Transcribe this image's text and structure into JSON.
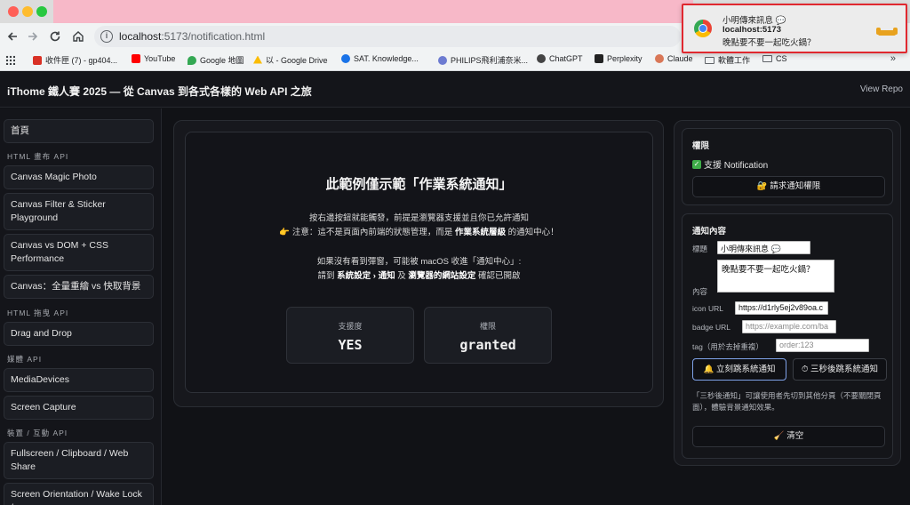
{
  "browser": {
    "url_host": "localhost",
    "url_path": ":5173/notification.html",
    "bookmarks": [
      {
        "label": "收件匣 (7) - gp404...",
        "icon": "gmail-icon",
        "color": "#d93025"
      },
      {
        "label": "YouTube",
        "icon": "youtube-icon",
        "color": "#ff0000"
      },
      {
        "label": "Google 地圖",
        "icon": "maps-icon",
        "color": "#34a853"
      },
      {
        "label": "以 - Google Drive",
        "icon": "drive-icon",
        "color": "#fbbc04"
      },
      {
        "label": "SAT. Knowledge...",
        "icon": "sat-icon",
        "color": "#1a73e8"
      },
      {
        "label": "PHILIPS飛利浦奈米...",
        "icon": "philips-icon",
        "color": "#6d7bd1"
      },
      {
        "label": "ChatGPT",
        "icon": "chatgpt-icon",
        "color": "#444"
      },
      {
        "label": "Perplexity",
        "icon": "perplexity-icon",
        "color": "#222"
      },
      {
        "label": "Claude",
        "icon": "claude-icon",
        "color": "#d97757"
      },
      {
        "label": "軟體工作",
        "icon": "folder-icon",
        "color": ""
      },
      {
        "label": "CS",
        "icon": "folder-icon",
        "color": ""
      }
    ],
    "more": "»"
  },
  "site": {
    "title": "iThome 鐵人賽 2025 — 從 Canvas 到各式各樣的 Web API 之旅",
    "view_repo": "View Repo"
  },
  "sidebar": {
    "home": "首頁",
    "sections": [
      {
        "title": "HTML 畫布 API"
      },
      {
        "title": "HTML 拖曳 API"
      },
      {
        "title": "媒體 API"
      },
      {
        "title": "裝置 / 互動 API"
      }
    ],
    "items": [
      {
        "label": "Canvas Magic Photo"
      },
      {
        "label": "Canvas Filter & Sticker Playground"
      },
      {
        "label": "Canvas vs DOM + CSS Performance"
      },
      {
        "label": "Canvas：全量重繪 vs 快取背景"
      },
      {
        "label": "Drag and Drop"
      },
      {
        "label": "MediaDevices"
      },
      {
        "label": "Screen Capture"
      },
      {
        "label": "Fullscreen / Clipboard / Web Share"
      },
      {
        "label": "Screen Orientation / Wake Lock /"
      }
    ]
  },
  "main": {
    "heading": "此範例僅示範「作業系統通知」",
    "line1": "按右邊按鈕就能觸發，前提是瀏覽器支援並且你已允許通知",
    "line2_prefix": "👉 注意：這不是頁面內前端的狀態管理，而是 ",
    "line2_bold": "作業系統層級",
    "line2_suffix": " 的通知中心！",
    "line3": "如果沒有看到彈窗，可能被 macOS 收進「通知中心」:",
    "line4_a": "請到 ",
    "line4_b": "系統設定 › 通知",
    "line4_c": " 及 ",
    "line4_d": "瀏覽器的網站設定",
    "line4_e": " 確認已開啟",
    "support_label": "支援度",
    "support_value": "YES",
    "permission_label": "權限",
    "permission_value": "granted"
  },
  "permission_card": {
    "title": "權限",
    "support_text": "支援 Notification",
    "request_button": "🔐 請求通知權限"
  },
  "content_card": {
    "title": "通知內容",
    "title_label": "標題",
    "title_value": "小明傳來訊息 💬",
    "content_label": "內容",
    "content_value": "晚點要不要一起吃火鍋？",
    "icon_label": "icon URL",
    "icon_value": "https://d1rly5ej2v89oa.c",
    "badge_label": "badge URL",
    "badge_placeholder": "https://example.com/ba",
    "tag_label": "tag（用於去掉重複）",
    "tag_placeholder": "order:123",
    "send_now": "🔔 立刻跳系統通知",
    "send_later": "⏱ 三秒後跳系統通知",
    "hint": "「三秒後通知」可讓使用者先切到其他分頁（不要關閉頁面），體驗背景通知效果。",
    "clear": "🧹 清空"
  },
  "toast": {
    "title": "小明傳來訊息 💬",
    "site": "localhost:5173",
    "body": "晚點要不要一起吃火鍋？"
  }
}
